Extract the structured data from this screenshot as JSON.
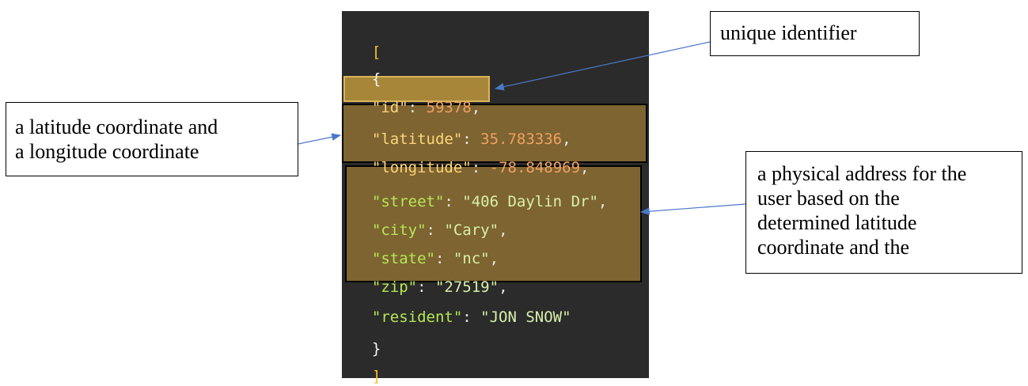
{
  "code": {
    "open_bracket": "[",
    "open_brace": "{",
    "id_key": "\"id\"",
    "id_value": "59378",
    "latitude_key": "\"latitude\"",
    "latitude_value": "35.783336",
    "longitude_key": "\"longitude\"",
    "longitude_value": "-78.848969",
    "street_key": "\"street\"",
    "street_value": "\"406 Daylin Dr\"",
    "city_key": "\"city\"",
    "city_value": "\"Cary\"",
    "state_key": "\"state\"",
    "state_value": "\"nc\"",
    "zip_key": "\"zip\"",
    "zip_value": "\"27519\"",
    "resident_key": "\"resident\"",
    "resident_value": "\"JON SNOW\"",
    "close_brace": "}",
    "close_bracket": "]"
  },
  "callouts": {
    "unique_identifier": "unique identifier",
    "coordinates_line1": "a latitude coordinate and",
    "coordinates_line2": "a longitude coordinate",
    "address_line1": "a physical address for the",
    "address_line2": "user based on the",
    "address_line3": "determined latitude",
    "address_line4": "coordinate and the"
  },
  "colors": {
    "panel_bg": "#2b2b2b",
    "highlight": "#8c6e32",
    "arrow": "#4a78c8"
  }
}
